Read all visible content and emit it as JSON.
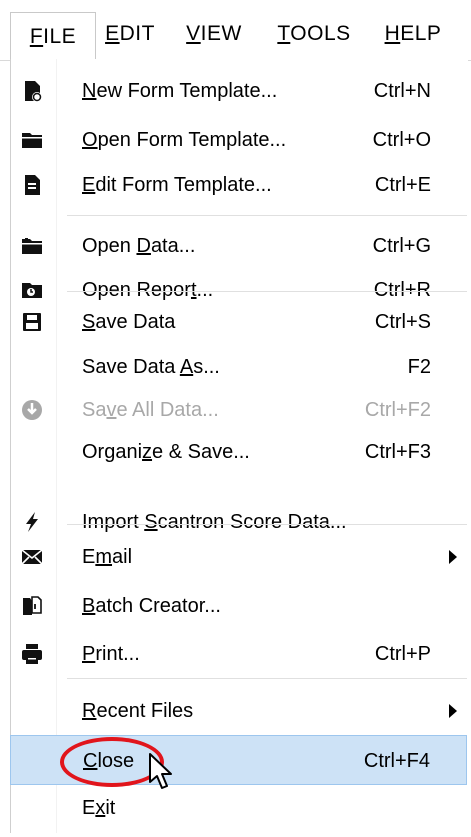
{
  "menubar": {
    "items": [
      {
        "id": "file",
        "label": "FILE",
        "mnemonic": 0
      },
      {
        "id": "edit",
        "label": "EDIT",
        "mnemonic": 0
      },
      {
        "id": "view",
        "label": "VIEW",
        "mnemonic": 0
      },
      {
        "id": "tools",
        "label": "TOOLS",
        "mnemonic": 0
      },
      {
        "id": "help",
        "label": "HELP",
        "mnemonic": 0
      }
    ]
  },
  "menu": {
    "items": [
      {
        "label": "New Form Template...",
        "mnemonic": 0,
        "shortcut": "Ctrl+N",
        "icon": "new-template-icon"
      },
      {
        "label": "Open Form Template...",
        "mnemonic": 0,
        "shortcut": "Ctrl+O",
        "icon": "open-folder-icon"
      },
      {
        "label": "Edit Form Template...",
        "mnemonic": 0,
        "shortcut": "Ctrl+E",
        "icon": "edit-template-icon"
      },
      {
        "label": "Open Data...",
        "mnemonic": 5,
        "shortcut": "Ctrl+G",
        "icon": "open-data-icon"
      },
      {
        "label": "Open Report...",
        "mnemonic": 10,
        "shortcut": "Ctrl+R",
        "icon": "open-report-icon"
      },
      {
        "label": "Save Data",
        "mnemonic": 0,
        "shortcut": "Ctrl+S",
        "icon": "save-disk-icon"
      },
      {
        "label": "Save Data As...",
        "mnemonic": 10,
        "shortcut": "F2",
        "icon": ""
      },
      {
        "label": "Save All Data...",
        "mnemonic": 2,
        "shortcut": "Ctrl+F2",
        "icon": "save-all-icon",
        "disabled": true
      },
      {
        "label": "Organize & Save...",
        "mnemonic": 6,
        "shortcut": "Ctrl+F3",
        "icon": ""
      },
      {
        "label": "Import Scantron Score Data...",
        "mnemonic": 7,
        "shortcut": "",
        "icon": "lightning-icon"
      },
      {
        "label": "Email",
        "mnemonic": 1,
        "shortcut": "",
        "icon": "email-envelope-icon",
        "submenu": true
      },
      {
        "label": "Batch Creator...",
        "mnemonic": 0,
        "shortcut": "",
        "icon": "batch-creator-icon"
      },
      {
        "label": "Print...",
        "mnemonic": 0,
        "shortcut": "Ctrl+P",
        "icon": "printer-icon"
      },
      {
        "label": "Recent Files",
        "mnemonic": 0,
        "shortcut": "",
        "icon": "",
        "submenu": true
      },
      {
        "label": "Close",
        "mnemonic": 0,
        "shortcut": "Ctrl+F4",
        "icon": "",
        "highlighted": true
      },
      {
        "label": "Exit",
        "mnemonic": 1,
        "shortcut": "",
        "icon": ""
      }
    ]
  },
  "colors": {
    "highlight_bg": "#cde2f6",
    "highlight_border": "#9dc6ee",
    "callout_red": "#e1151c",
    "disabled_text": "#a8a8a8"
  }
}
